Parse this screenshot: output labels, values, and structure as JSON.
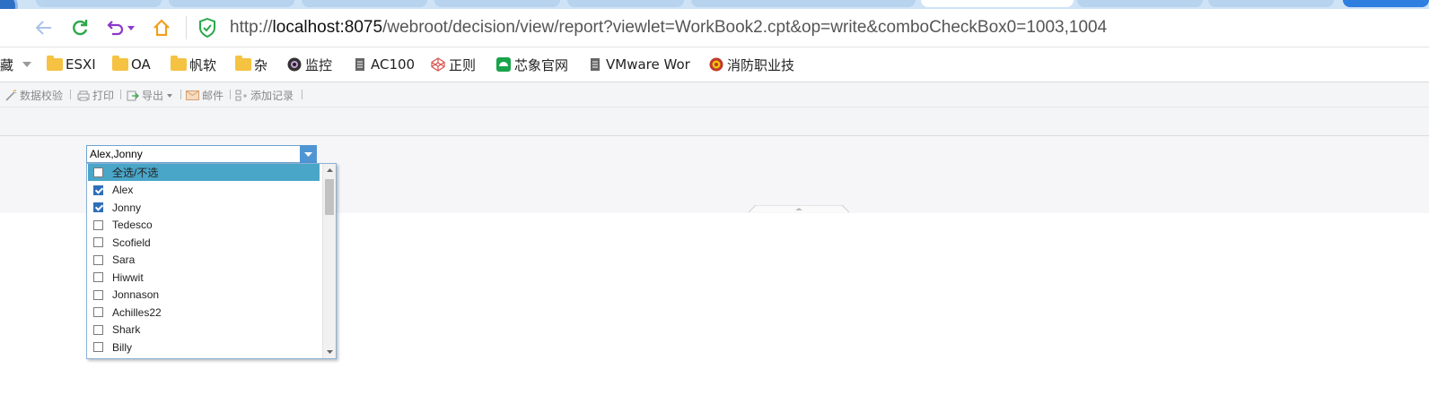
{
  "browser": {
    "url_prefix": "http://",
    "url_host": "localhost:8075",
    "url_path": "/webroot/decision/view/report?viewlet=WorkBook2.cpt&op=write&comboCheckBox0=1003,1004"
  },
  "bookmarks": [
    {
      "label": "藏",
      "icon": "truncated-label"
    },
    {
      "label": "ESXI",
      "icon": "folder-icon"
    },
    {
      "label": "OA",
      "icon": "folder-icon"
    },
    {
      "label": "帆软",
      "icon": "folder-icon"
    },
    {
      "label": "杂",
      "icon": "folder-icon"
    },
    {
      "label": "监控",
      "icon": "camera-icon"
    },
    {
      "label": "AC100",
      "icon": "page-icon"
    },
    {
      "label": "正则",
      "icon": "codepen-icon"
    },
    {
      "label": "芯象官网",
      "icon": "green-app-icon"
    },
    {
      "label": "VMware Wor",
      "icon": "page-icon"
    },
    {
      "label": "消防职业技",
      "icon": "badge-icon"
    }
  ],
  "toolbar": {
    "validate": "数据校验",
    "print": "打印",
    "export": "导出",
    "email": "邮件",
    "add_record": "添加记录"
  },
  "combo": {
    "value": "Alex,Jonny",
    "options": [
      {
        "label": "全选/不选",
        "checked": false,
        "highlighted": true
      },
      {
        "label": "Alex",
        "checked": true,
        "highlighted": false
      },
      {
        "label": "Jonny",
        "checked": true,
        "highlighted": false
      },
      {
        "label": "Tedesco",
        "checked": false,
        "highlighted": false
      },
      {
        "label": "Scofield",
        "checked": false,
        "highlighted": false
      },
      {
        "label": "Sara",
        "checked": false,
        "highlighted": false
      },
      {
        "label": "Hiwwit",
        "checked": false,
        "highlighted": false
      },
      {
        "label": "Jonnason",
        "checked": false,
        "highlighted": false
      },
      {
        "label": "Achilles22",
        "checked": false,
        "highlighted": false
      },
      {
        "label": "Shark",
        "checked": false,
        "highlighted": false
      },
      {
        "label": "Billy",
        "checked": false,
        "highlighted": false
      }
    ]
  },
  "colors": {
    "accent": "#4f95d3",
    "highlight": "#4aa6c8",
    "checked": "#2d6fb8"
  }
}
